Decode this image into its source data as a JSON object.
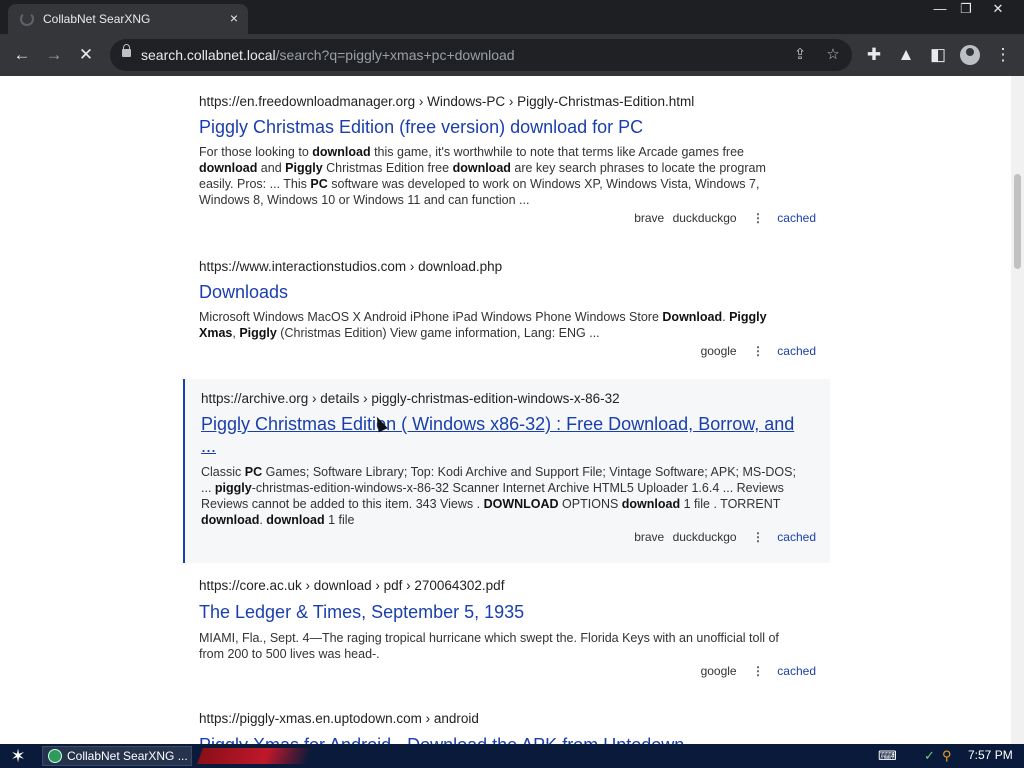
{
  "browser": {
    "tab_title": "CollabNet SearXNG",
    "tab_close": "×",
    "window_controls": {
      "minimize": "—",
      "maximize": "❐",
      "close": "✕"
    },
    "nav": {
      "back": "←",
      "forward": "→",
      "stop": "✕"
    },
    "url_host": "search.collabnet.local",
    "url_path": "/search?q=piggly+xmas+pc+download",
    "icons": [
      "share-icon",
      "star-icon",
      "extensions-icon",
      "lab-icon",
      "sidepanel-icon",
      "profile-icon",
      "menu-icon"
    ]
  },
  "results": [
    {
      "url": "https://en.freedownloadmanager.org  › Windows-PC › Piggly-Christmas-Edition.html",
      "title": "Piggly Christmas Edition (free version) download for PC",
      "snippet_html": "For those looking to <b>download</b> this game, it's worthwhile to note that terms like Arcade games free <b>download</b> and <b>Piggly</b> Christmas Edition free <b>download</b> are key search phrases to locate the program easily. Pros: ... This <b>PC</b> software was developed to work on Windows XP, Windows Vista, Windows 7, Windows 8, Windows 10 or Windows 11 and can function ...",
      "engines": [
        "brave",
        "duckduckgo"
      ],
      "cached": "cached"
    },
    {
      "url": "https://www.interactionstudios.com  › download.php",
      "title": "Downloads",
      "snippet_html": "Microsoft Windows MacOS X Android iPhone iPad Windows Phone Windows Store <b>Download</b>. <b>Piggly Xmas</b>, <b>Piggly</b> (Christmas Edition) View game information, Lang: ENG ...",
      "engines": [
        "google"
      ],
      "cached": "cached"
    },
    {
      "url": "https://archive.org  › details › piggly-christmas-edition-windows-x-86-32",
      "title": "Piggly Christmas Edition ( Windows x86-32) : Free Download, Borrow, and ...",
      "snippet_html": "Classic <b>PC</b> Games; Software Library; Top: Kodi Archive and Support File; Vintage Software; APK; MS-DOS; ... <b>piggly</b>-christmas-edition-windows-x-86-32 Scanner Internet Archive HTML5 Uploader 1.6.4 ... Reviews Reviews cannot be added to this item. 343 Views . <b>DOWNLOAD</b> OPTIONS <b>download</b> 1 file . TORRENT <b>download</b>. <b>download</b> 1 file",
      "engines": [
        "brave",
        "duckduckgo"
      ],
      "cached": "cached"
    },
    {
      "url": "https://core.ac.uk  › download › pdf › 270064302.pdf",
      "title": "The Ledger & Times, September 5, 1935",
      "snippet_html": "MIAMI, Fla., Sept. 4—The raging tropical hurricane which swept the. Florida Keys with an unofficial toll of from 200 to 500 lives was head-.",
      "engines": [
        "google"
      ],
      "cached": "cached"
    },
    {
      "url": "https://piggly-xmas.en.uptodown.com  › android",
      "title": "Piggly Xmas for Android - Download the APK from Uptodown",
      "snippet_html": "",
      "engines": [],
      "cached": ""
    }
  ],
  "taskbar": {
    "start": "✶",
    "task_label": "CollabNet SearXNG ...",
    "clock": "7:57 PM"
  }
}
